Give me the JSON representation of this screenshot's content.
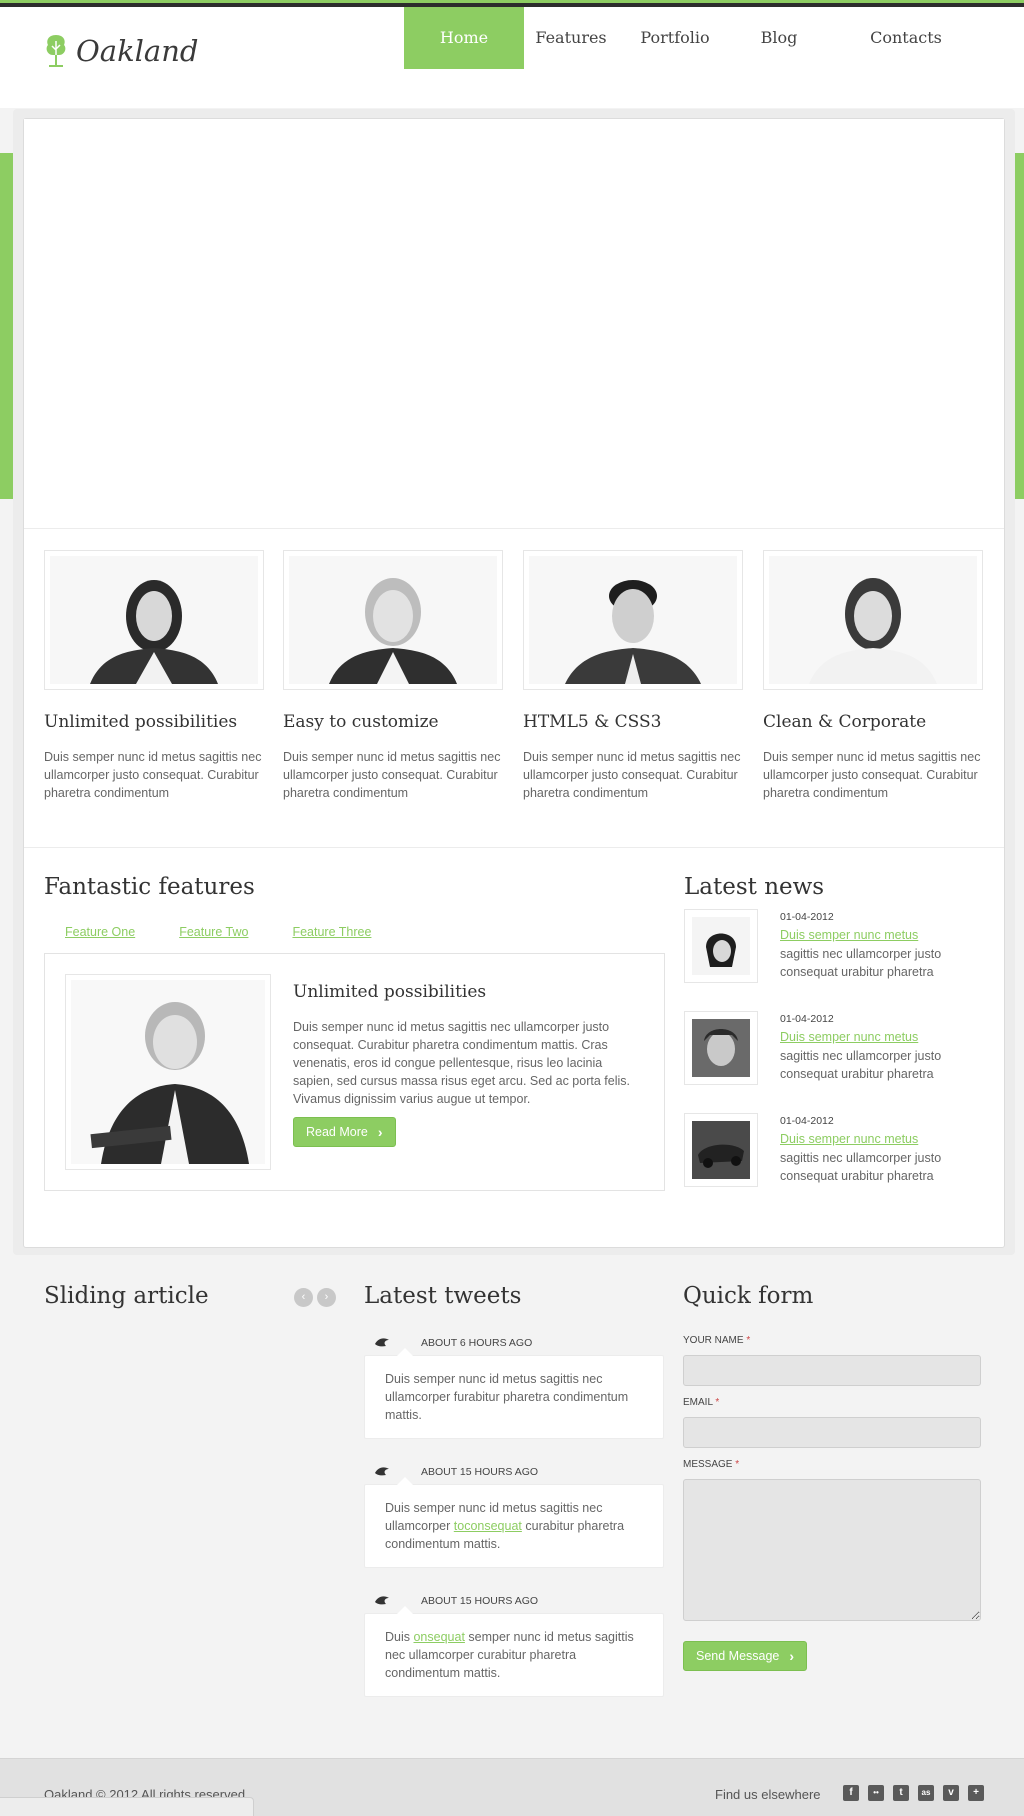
{
  "brand": {
    "name": "Oakland",
    "accent": "#8dcd62"
  },
  "nav": [
    {
      "label": "Home",
      "active": true
    },
    {
      "label": "Features",
      "active": false
    },
    {
      "label": "Portfolio",
      "active": false
    },
    {
      "label": "Blog",
      "active": false
    },
    {
      "label": "Contacts",
      "active": false
    }
  ],
  "team": [
    {
      "title": "Unlimited possibilities",
      "text": "Duis semper nunc id metus sagittis nec ullamcorper justo consequat. Curabitur pharetra condimentum"
    },
    {
      "title": "Easy to customize",
      "text": "Duis semper nunc id metus sagittis nec ullamcorper justo consequat. Curabitur pharetra condimentum"
    },
    {
      "title": "HTML5 & CSS3",
      "text": "Duis semper nunc id metus sagittis nec ullamcorper justo consequat. Curabitur pharetra condimentum"
    },
    {
      "title": "Clean & Corporate",
      "text": "Duis semper nunc id metus sagittis nec ullamcorper justo consequat. Curabitur pharetra condimentum"
    }
  ],
  "features": {
    "title": "Fantastic features",
    "tabs": [
      "Feature One",
      "Feature Two",
      "Feature Three"
    ],
    "panel_title": "Unlimited possibilities",
    "panel_text": "Duis semper nunc id metus sagittis nec ullamcorper justo consequat. Curabitur pharetra condimentum mattis. Cras venenatis, eros id congue pellentesque, risus leo lacinia sapien, sed cursus massa risus eget arcu. Sed ac porta felis. Vivamus dignissim varius augue ut tempor.",
    "button": "Read More"
  },
  "news": {
    "title": "Latest news",
    "items": [
      {
        "date": "01-04-2012",
        "link": "Duis semper nunc metus",
        "text": "sagittis nec ullamcorper justo consequat urabitur pharetra"
      },
      {
        "date": "01-04-2012",
        "link": "Duis semper nunc metus",
        "text": "sagittis nec ullamcorper justo consequat urabitur pharetra"
      },
      {
        "date": "01-04-2012",
        "link": "Duis semper nunc metus",
        "text": "sagittis nec ullamcorper justo consequat urabitur pharetra"
      }
    ]
  },
  "sliding": {
    "title": "Sliding article"
  },
  "tweets": {
    "title": "Latest tweets",
    "items": [
      {
        "time": "ABOUT 6 HOURS AGO",
        "pre": "Duis semper nunc id metus sagittis nec ullamcorper furabitur pharetra condimentum mattis.",
        "link": "",
        "post": ""
      },
      {
        "time": "ABOUT 15 HOURS AGO",
        "pre": "Duis semper nunc id metus sagittis nec ullamcorper ",
        "link": "toconsequat",
        "post": " curabitur pharetra condimentum mattis."
      },
      {
        "time": "ABOUT 15 HOURS AGO",
        "pre": "Duis ",
        "link": "onsequat",
        "post": " semper nunc id metus sagittis nec ullamcorper curabitur pharetra condimentum mattis."
      }
    ]
  },
  "form": {
    "title": "Quick form",
    "name_label": "YOUR NAME",
    "email_label": "EMAIL",
    "message_label": "MESSAGE",
    "required_mark": "*",
    "button": "Send Message"
  },
  "footer": {
    "copyright": "Oakland © 2012 All rights reserved",
    "find_us": "Find us elsewhere",
    "socials": [
      {
        "icon": "facebook-icon",
        "glyph": "f"
      },
      {
        "icon": "flickr-icon",
        "glyph": "••"
      },
      {
        "icon": "twitter-icon",
        "glyph": "t"
      },
      {
        "icon": "lastfm-icon",
        "glyph": "as"
      },
      {
        "icon": "vimeo-icon",
        "glyph": "v"
      },
      {
        "icon": "googleplus-icon",
        "glyph": "+"
      }
    ]
  }
}
